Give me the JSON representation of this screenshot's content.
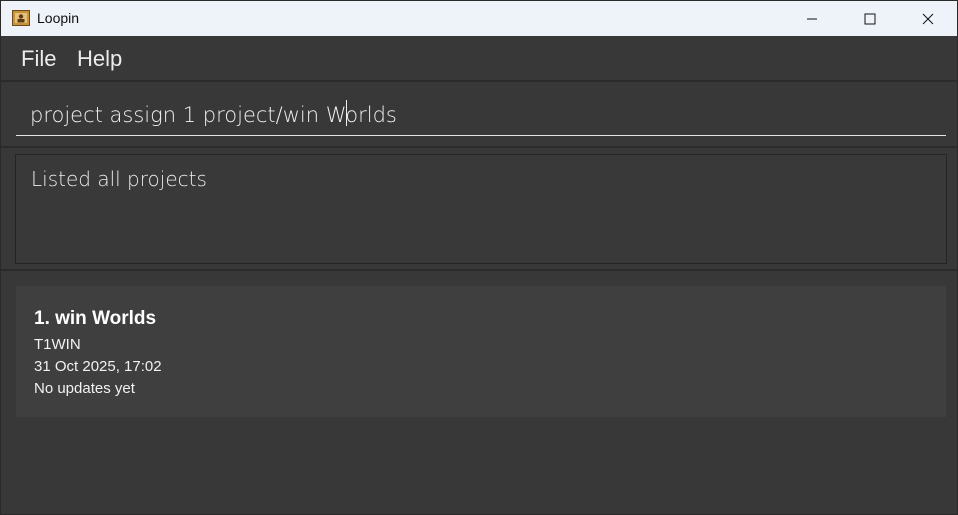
{
  "window": {
    "title": "Loopin",
    "controls": {
      "minimize_icon": "minimize-icon",
      "maximize_icon": "maximize-icon",
      "close_icon": "close-icon"
    }
  },
  "menu": {
    "items": [
      {
        "label": "File"
      },
      {
        "label": "Help"
      }
    ]
  },
  "command_box": {
    "value": "project assign 1 project/win Worlds"
  },
  "result_display": {
    "text": "Listed all projects"
  },
  "projects": [
    {
      "title": "1. win Worlds",
      "code": "T1WIN",
      "timestamp": "31 Oct 2025, 17:02",
      "status": "No updates yet"
    }
  ],
  "colors": {
    "background": "#383838",
    "titlebar": "#eef3fa",
    "card": "#3f3f3f",
    "text": "#ffffff"
  }
}
